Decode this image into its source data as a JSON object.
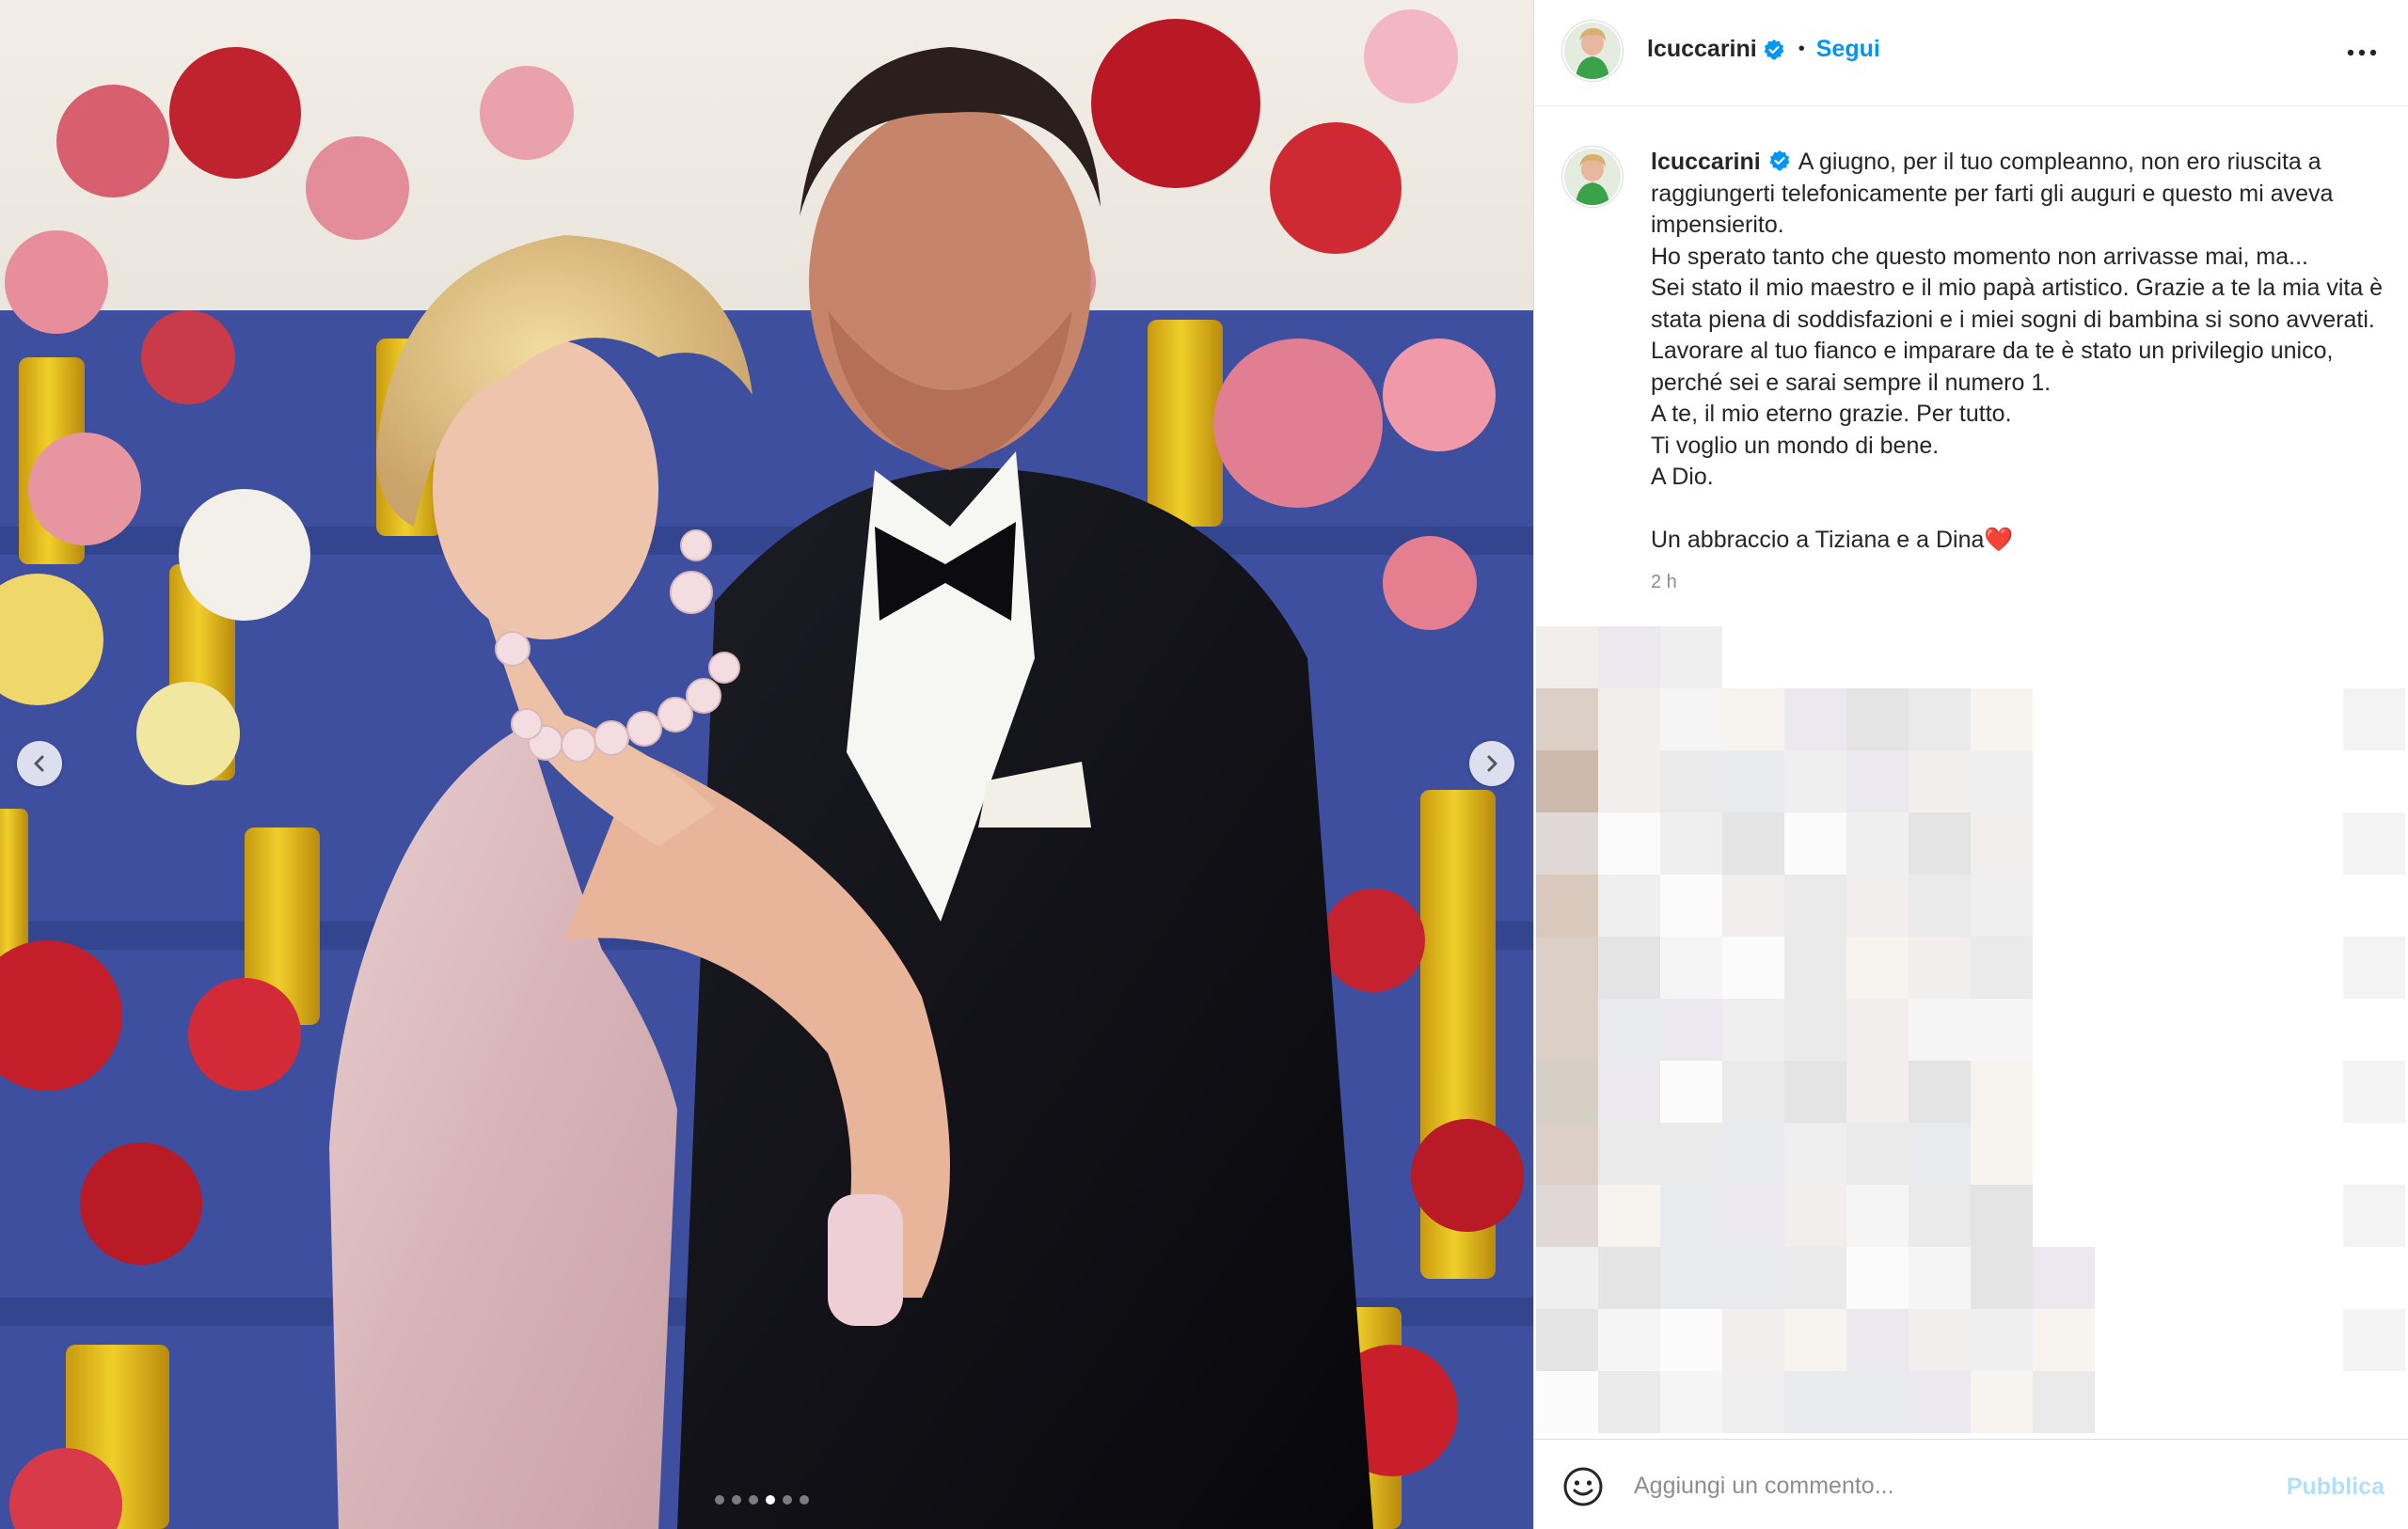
{
  "post": {
    "username": "lcuccarini",
    "verified": true,
    "follow_label": "Segui",
    "separator": "•",
    "caption_lines": [
      "A giugno, per il tuo compleanno, non ero riuscita a raggiungerti telefonicamente per farti gli auguri e questo mi aveva impensierito.",
      "Ho sperato tanto che questo momento non arrivasse mai, ma...",
      "Sei stato il mio maestro e il mio papà artistico. Grazie a te la mia vita è stata piena di soddisfazioni e i miei sogni di bambina si sono avverati. Lavorare al tuo fianco e imparare da te è stato un privilegio unico, perché sei e sarai sempre il numero 1.",
      "A te, il mio eterno grazie. Per tutto.",
      "Ti voglio un mondo di bene.",
      "A Dio.",
      "",
      "Un abbraccio a Tiziana e a Dina❤️"
    ],
    "timestamp": "2 h"
  },
  "carousel": {
    "dot_count": 6,
    "active_index": 3
  },
  "comment_bar": {
    "placeholder": "Aggiungi un commento...",
    "publish_label": "Pubblica"
  },
  "icons": {
    "verified": "verified-badge-icon",
    "more": "more-options-icon",
    "prev": "chevron-left-icon",
    "next": "chevron-right-icon",
    "emoji": "emoji-smiley-icon"
  },
  "colors": {
    "accent": "#0095f6",
    "accent_disabled": "#b2dffc",
    "muted": "#8e8e8e",
    "text": "#262626",
    "border": "#dbdbdb"
  }
}
